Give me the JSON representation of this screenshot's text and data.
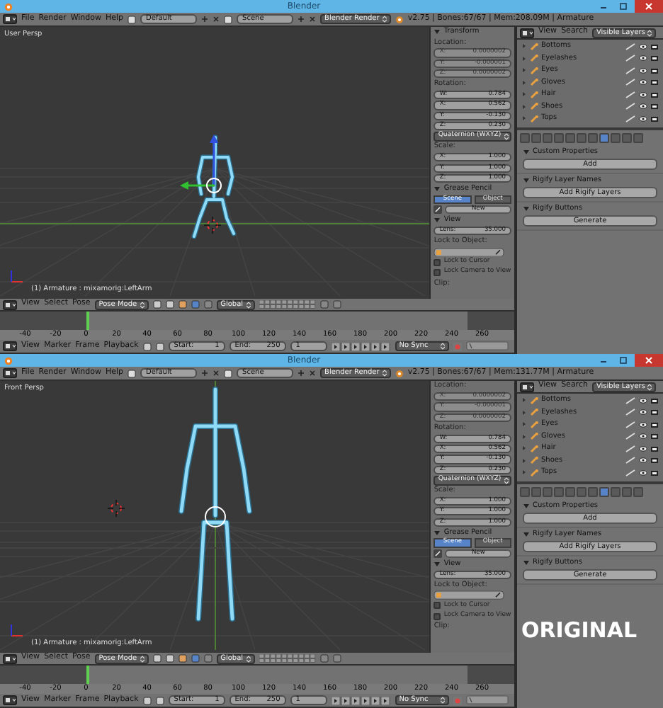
{
  "windows": [
    {
      "title": "Blender",
      "menu": [
        "File",
        "Render",
        "Window",
        "Help"
      ],
      "layout": "Default",
      "scene": "Scene",
      "engine": "Blender Render",
      "stats": "v2.75 | Bones:67/67 | Mem:208.09M | Armature",
      "viewport": {
        "view_label": "User Persp",
        "info": "(1) Armature : mixamorig:LeftArm",
        "kind": "walking"
      },
      "n_panel": [
        {
          "kind": "section",
          "title": "Transform",
          "expanded": true
        },
        {
          "kind": "label",
          "text": "Location:"
        },
        {
          "kind": "field",
          "label": "X:",
          "value": "0.0000002",
          "disabled": true
        },
        {
          "kind": "field",
          "label": "Y:",
          "value": "-0.000001",
          "disabled": true
        },
        {
          "kind": "field",
          "label": "Z:",
          "value": "0.0000002",
          "disabled": true
        },
        {
          "kind": "label",
          "text": "Rotation:"
        },
        {
          "kind": "field",
          "label": "W:",
          "value": "0.784",
          "disabled": false
        },
        {
          "kind": "field",
          "label": "X:",
          "value": "0.562",
          "disabled": false
        },
        {
          "kind": "field",
          "label": "Y:",
          "value": "-0.130",
          "disabled": false
        },
        {
          "kind": "field",
          "label": "Z:",
          "value": "0.230",
          "disabled": false
        },
        {
          "kind": "dropdown",
          "text": "Quaternion (WXYZ)"
        },
        {
          "kind": "label",
          "text": "Scale:"
        },
        {
          "kind": "field",
          "label": "X:",
          "value": "1.000",
          "disabled": false
        },
        {
          "kind": "field",
          "label": "Y:",
          "value": "1.000",
          "disabled": false
        },
        {
          "kind": "field",
          "label": "Z:",
          "value": "1.000",
          "disabled": false
        },
        {
          "kind": "section",
          "title": "Grease Pencil",
          "expanded": true
        },
        {
          "kind": "toggle",
          "options": [
            {
              "label": "Scene",
              "selected": true
            },
            {
              "label": "Object",
              "selected": false
            }
          ]
        },
        {
          "kind": "button",
          "text": "New"
        },
        {
          "kind": "section",
          "title": "View",
          "expanded": true
        },
        {
          "kind": "field",
          "label": "Lens:",
          "value": "35.000",
          "disabled": false
        },
        {
          "kind": "label",
          "text": "Lock to Object:"
        },
        {
          "kind": "object_field"
        },
        {
          "kind": "checkbox",
          "label": "Lock to Cursor",
          "checked": false
        },
        {
          "kind": "checkbox",
          "label": "Lock Camera to View",
          "checked": false
        },
        {
          "kind": "label",
          "text": "Clip:"
        }
      ],
      "view_header": {
        "menu": [
          "View",
          "Select",
          "Pose"
        ],
        "mode": "Pose Mode",
        "orientation": "Global"
      },
      "timeline": {
        "ticks": [
          "-40",
          "-20",
          "0",
          "20",
          "40",
          "60",
          "80",
          "100",
          "120",
          "140",
          "160",
          "180",
          "200",
          "220",
          "240",
          "260"
        ],
        "menu": [
          "View",
          "Marker",
          "Frame",
          "Playback"
        ],
        "start_label": "Start:",
        "start": "1",
        "end_label": "End:",
        "end": "250",
        "frame": "1",
        "sync": "No Sync"
      },
      "outliner": {
        "menu": [
          "View",
          "Search"
        ],
        "filter": "Visible Layers",
        "items": [
          "Bottoms",
          "Eyelashes",
          "Eyes",
          "Gloves",
          "Hair",
          "Shoes",
          "Tops"
        ]
      },
      "property_tabs": [
        {
          "selected": false
        },
        {
          "selected": false
        },
        {
          "selected": false
        },
        {
          "selected": false
        },
        {
          "selected": false
        },
        {
          "selected": false
        },
        {
          "selected": false
        },
        {
          "selected": true
        },
        {
          "selected": false
        },
        {
          "selected": false
        },
        {
          "selected": false
        }
      ],
      "panels": [
        {
          "title": "Custom Properties",
          "expanded": true,
          "button": "Add"
        },
        {
          "title": "Rigify Layer Names",
          "expanded": true,
          "button": "Add Rigify Layers"
        },
        {
          "title": "Rigify Buttons",
          "expanded": true,
          "button": "Generate"
        }
      ]
    },
    {
      "title": "Blender",
      "menu": [
        "File",
        "Render",
        "Window",
        "Help"
      ],
      "layout": "Default",
      "scene": "Scene",
      "engine": "Blender Render",
      "stats": "v2.75 | Bones:67/67 | Mem:131.77M | Armature",
      "viewport": {
        "view_label": "Front Persp",
        "info": "(1) Armature : mixamorig:LeftArm",
        "kind": "standing"
      },
      "n_panel": [
        {
          "kind": "label",
          "text": "Location:"
        },
        {
          "kind": "field",
          "label": "X:",
          "value": "0.0000002",
          "disabled": true
        },
        {
          "kind": "field",
          "label": "Y:",
          "value": "-0.000001",
          "disabled": true
        },
        {
          "kind": "field",
          "label": "Z:",
          "value": "0.0000002",
          "disabled": true
        },
        {
          "kind": "label",
          "text": "Rotation:"
        },
        {
          "kind": "field",
          "label": "W:",
          "value": "0.784",
          "disabled": false
        },
        {
          "kind": "field",
          "label": "X:",
          "value": "0.562",
          "disabled": false
        },
        {
          "kind": "field",
          "label": "Y:",
          "value": "-0.130",
          "disabled": false
        },
        {
          "kind": "field",
          "label": "Z:",
          "value": "0.230",
          "disabled": false
        },
        {
          "kind": "dropdown",
          "text": "Quaternion (WXYZ)"
        },
        {
          "kind": "label",
          "text": "Scale:"
        },
        {
          "kind": "field",
          "label": "X:",
          "value": "1.000",
          "disabled": false
        },
        {
          "kind": "field",
          "label": "Y:",
          "value": "1.000",
          "disabled": false
        },
        {
          "kind": "field",
          "label": "Z:",
          "value": "1.000",
          "disabled": false
        },
        {
          "kind": "section",
          "title": "Grease Pencil",
          "expanded": true
        },
        {
          "kind": "toggle",
          "options": [
            {
              "label": "Scene",
              "selected": true
            },
            {
              "label": "Object",
              "selected": false
            }
          ]
        },
        {
          "kind": "button",
          "text": "New"
        },
        {
          "kind": "section",
          "title": "View",
          "expanded": true
        },
        {
          "kind": "field",
          "label": "Lens:",
          "value": "35.000",
          "disabled": false
        },
        {
          "kind": "label",
          "text": "Lock to Object:"
        },
        {
          "kind": "object_field"
        },
        {
          "kind": "checkbox",
          "label": "Lock to Cursor",
          "checked": false
        },
        {
          "kind": "checkbox",
          "label": "Lock Camera to View",
          "checked": false
        },
        {
          "kind": "label",
          "text": "Clip:"
        }
      ],
      "view_header": {
        "menu": [
          "View",
          "Select",
          "Pose"
        ],
        "mode": "Pose Mode",
        "orientation": "Global"
      },
      "timeline": {
        "ticks": [
          "-40",
          "-20",
          "0",
          "20",
          "40",
          "60",
          "80",
          "100",
          "120",
          "140",
          "160",
          "180",
          "200",
          "220",
          "240",
          "260"
        ],
        "menu": [
          "View",
          "Marker",
          "Frame",
          "Playback"
        ],
        "start_label": "Start:",
        "start": "1",
        "end_label": "End:",
        "end": "250",
        "frame": "1",
        "sync": "No Sync"
      },
      "outliner": {
        "menu": [
          "View",
          "Search"
        ],
        "filter": "Visible Layers",
        "items": [
          "Bottoms",
          "Eyelashes",
          "Eyes",
          "Gloves",
          "Hair",
          "Shoes",
          "Tops"
        ]
      },
      "property_tabs": [
        {
          "selected": false
        },
        {
          "selected": false
        },
        {
          "selected": false
        },
        {
          "selected": false
        },
        {
          "selected": false
        },
        {
          "selected": false
        },
        {
          "selected": false
        },
        {
          "selected": true
        },
        {
          "selected": false
        },
        {
          "selected": false
        },
        {
          "selected": false
        }
      ],
      "panels": [
        {
          "title": "Custom Properties",
          "expanded": true,
          "button": "Add"
        },
        {
          "title": "Rigify Layer Names",
          "expanded": true,
          "button": "Add Rigify Layers"
        },
        {
          "title": "Rigify Buttons",
          "expanded": true,
          "button": "Generate"
        }
      ]
    }
  ],
  "annotation": "ORIGINAL"
}
